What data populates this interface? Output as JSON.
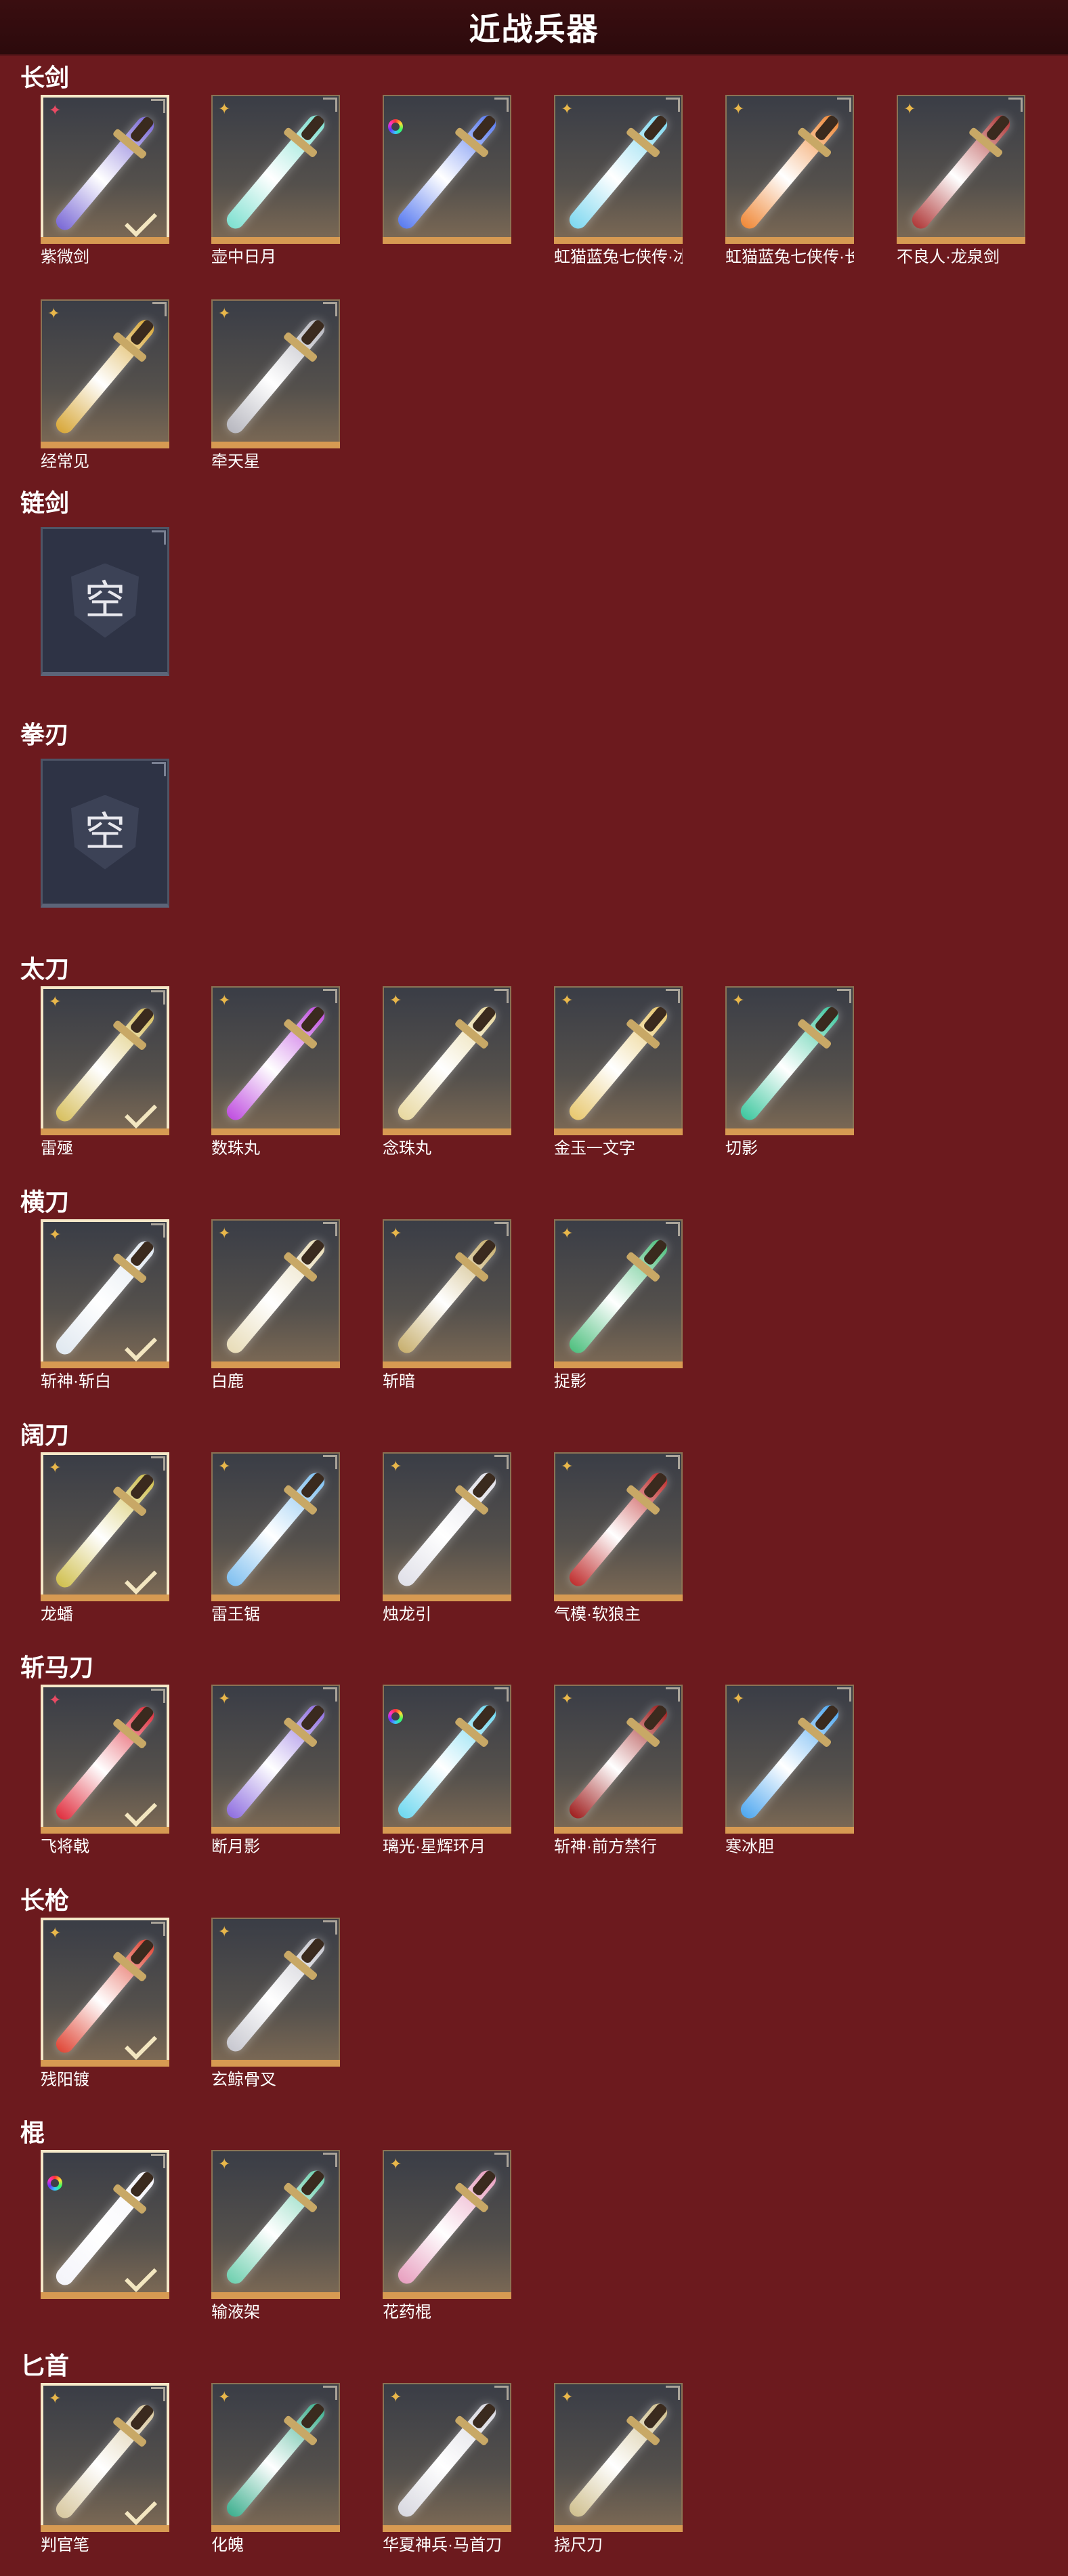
{
  "header": {
    "title": "近战兵器"
  },
  "empty_label": "空",
  "sections": [
    {
      "label": "长剑",
      "items": [
        {
          "name": "紫微剑",
          "rarity": "pink",
          "equipped": true,
          "color": "#7b6ad6"
        },
        {
          "name": "壶中日月",
          "rarity": "gold",
          "equipped": false,
          "color": "#7fe0d0"
        },
        {
          "name": "",
          "rarity": "rainbow",
          "equipped": false,
          "color": "#5a7cf0"
        },
        {
          "name": "虹猫蓝兔七侠传·冰魄剑",
          "rarity": "gold",
          "equipped": false,
          "color": "#7fd8f0"
        },
        {
          "name": "虹猫蓝兔七侠传·长虹剑",
          "rarity": "gold",
          "equipped": false,
          "color": "#f08a3a"
        },
        {
          "name": "不良人·龙泉剑",
          "rarity": "gold",
          "equipped": false,
          "color": "#b03a3a"
        },
        {
          "name": "经常见",
          "rarity": "gold",
          "equipped": false,
          "color": "#d8a83a"
        },
        {
          "name": "牵天星",
          "rarity": "gold",
          "equipped": false,
          "color": "#b8b8c0"
        }
      ]
    },
    {
      "label": "链剑",
      "items": []
    },
    {
      "label": "拳刃",
      "items": []
    },
    {
      "label": "太刀",
      "items": [
        {
          "name": "雷殛",
          "rarity": "gold",
          "equipped": true,
          "color": "#d8c060"
        },
        {
          "name": "数珠丸",
          "rarity": "gold",
          "equipped": false,
          "color": "#c050e0"
        },
        {
          "name": "念珠丸",
          "rarity": "gold",
          "equipped": false,
          "color": "#e8d8a0"
        },
        {
          "name": "金玉一文字",
          "rarity": "gold",
          "equipped": false,
          "color": "#e8c870"
        },
        {
          "name": "切影",
          "rarity": "gold",
          "equipped": false,
          "color": "#40c8a0"
        }
      ]
    },
    {
      "label": "横刀",
      "items": [
        {
          "name": "斩神·斩白",
          "rarity": "gold",
          "equipped": true,
          "color": "#e0e8f0"
        },
        {
          "name": "白鹿",
          "rarity": "gold",
          "equipped": false,
          "color": "#e8dcb8"
        },
        {
          "name": "斩暗",
          "rarity": "gold",
          "equipped": false,
          "color": "#c8b070"
        },
        {
          "name": "捉影",
          "rarity": "gold",
          "equipped": false,
          "color": "#50c080"
        }
      ]
    },
    {
      "label": "阔刀",
      "items": [
        {
          "name": "龙蟠",
          "rarity": "gold",
          "equipped": true,
          "color": "#d0c050"
        },
        {
          "name": "雷王锯",
          "rarity": "gold",
          "equipped": false,
          "color": "#80c0f0"
        },
        {
          "name": "烛龙引",
          "rarity": "gold",
          "equipped": false,
          "color": "#e0e0e8"
        },
        {
          "name": "气模·软狼主",
          "rarity": "gold",
          "equipped": false,
          "color": "#c03030"
        }
      ]
    },
    {
      "label": "斩马刀",
      "items": [
        {
          "name": "飞将戟",
          "rarity": "pink",
          "equipped": true,
          "color": "#e03040"
        },
        {
          "name": "断月影",
          "rarity": "gold",
          "equipped": false,
          "color": "#9070e0"
        },
        {
          "name": "璃光·星辉环月",
          "rarity": "rainbow",
          "equipped": false,
          "color": "#70d8f0"
        },
        {
          "name": "斩神·前方禁行",
          "rarity": "gold",
          "equipped": false,
          "color": "#a02020"
        },
        {
          "name": "寒冰胆",
          "rarity": "gold",
          "equipped": false,
          "color": "#50a8f0"
        }
      ]
    },
    {
      "label": "长枪",
      "items": [
        {
          "name": "残阳镀",
          "rarity": "gold",
          "equipped": true,
          "color": "#e04838"
        },
        {
          "name": "玄鲸骨叉",
          "rarity": "gold",
          "equipped": false,
          "color": "#c8c8d0"
        }
      ]
    },
    {
      "label": "棍",
      "items": [
        {
          "name": "",
          "rarity": "rainbow",
          "equipped": true,
          "color": "#f4f4fa"
        },
        {
          "name": "输液架",
          "rarity": "gold",
          "equipped": false,
          "color": "#70d0b0"
        },
        {
          "name": "花药棍",
          "rarity": "gold",
          "equipped": false,
          "color": "#e8a0c0"
        }
      ]
    },
    {
      "label": "匕首",
      "items": [
        {
          "name": "判官笔",
          "rarity": "gold",
          "equipped": true,
          "color": "#d8c8a0"
        },
        {
          "name": "化魄",
          "rarity": "gold",
          "equipped": false,
          "color": "#40b090"
        },
        {
          "name": "华夏神兵·马首刀",
          "rarity": "gold",
          "equipped": false,
          "color": "#d8d8e0"
        },
        {
          "name": "挠尺刀",
          "rarity": "gold",
          "equipped": false,
          "color": "#d0c090"
        }
      ]
    }
  ]
}
